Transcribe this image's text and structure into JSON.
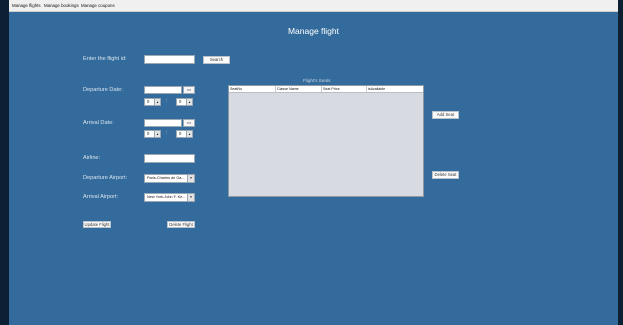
{
  "menu": {
    "items": [
      {
        "label": "Manage flights"
      },
      {
        "label": "Manage bookings"
      },
      {
        "label": "Manage coupons"
      }
    ]
  },
  "page": {
    "title": "Manage flight"
  },
  "form": {
    "flight_id_label": "Enter the flight id:",
    "flight_id_value": "",
    "search_label": "Search",
    "departure_date_label": "Departure Date:",
    "departure_date_value": "",
    "departure_hour": "0",
    "departure_minute": "0",
    "arrival_date_label": "Arrival Date:",
    "arrival_date_value": "",
    "arrival_hour": "0",
    "arrival_minute": "0",
    "time_separator": ":",
    "airline_label": "Airline:",
    "airline_value": "",
    "departure_airport_label": "Departure Airport:",
    "departure_airport_value": "Paris-Charles de Ga...",
    "arrival_airport_label": "Arrival Airport:",
    "arrival_airport_value": "New York-John F. Ke...",
    "update_flight_label": "Update Flight",
    "delete_flight_label": "Delete Flight"
  },
  "seats": {
    "title": "Flight's Seats",
    "columns": [
      "SeatNo",
      "Classe Name",
      "Seat Price",
      "isAvailable"
    ],
    "add_seat_label": "Add Seat",
    "delete_seat_label": "Delete Seat"
  },
  "icons": {
    "calendar": "calendar-icon",
    "spinner_arrow": "spinner-arrows-icon",
    "dropdown_arrow": "chevron-down-icon"
  },
  "colors": {
    "outer_background": "#0d1f33",
    "panel_background": "#336b9c",
    "table_background": "#d7dbe1"
  }
}
